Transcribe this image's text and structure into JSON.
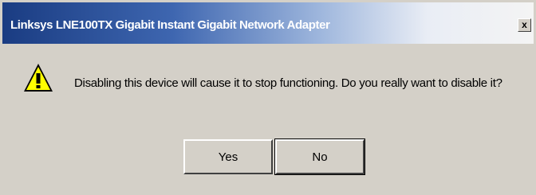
{
  "dialog": {
    "title": "Linksys LNE100TX Gigabit Instant Gigabit Network Adapter",
    "close_label": "x",
    "message": "Disabling this device will cause it to stop functioning. Do you really want to disable it?",
    "icon": "warning-icon",
    "buttons": {
      "yes_label": "Yes",
      "no_label": "No"
    }
  }
}
